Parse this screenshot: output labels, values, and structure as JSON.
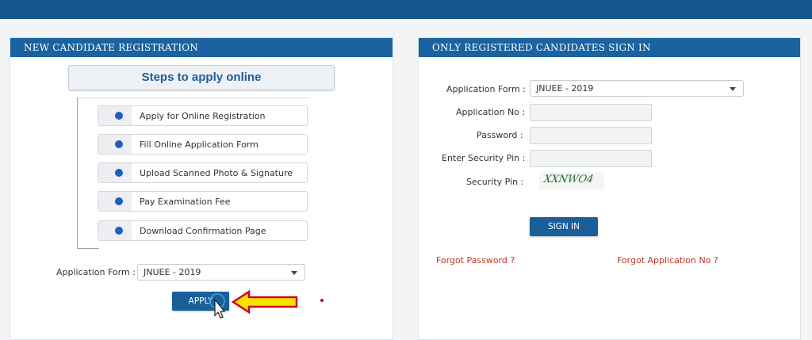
{
  "registration": {
    "header": "NEW CANDIDATE REGISTRATION",
    "steps_title": "Steps to apply online",
    "steps": [
      "Apply for Online Registration",
      "Fill Online Application Form",
      "Upload Scanned Photo & Signature",
      "Pay Examination Fee",
      "Download Confirmation Page"
    ],
    "app_form_label": "Application Form :",
    "app_form_value": "JNUEE - 2019",
    "apply_label": "APPLY"
  },
  "signin": {
    "header": "ONLY REGISTERED CANDIDATES SIGN IN",
    "app_form_label": "Application Form :",
    "app_form_value": "JNUEE - 2019",
    "app_no_label": "Application No :",
    "password_label": "Password :",
    "enter_pin_label": "Enter Security Pin :",
    "pin_label": "Security Pin :",
    "captcha_text": "XXNWO4",
    "sign_in_label": "SIGN IN",
    "forgot_password": "Forgot Password ?",
    "forgot_app_no": "Forgot Application No ?"
  },
  "colors": {
    "topbar": "#14578f",
    "panel_header": "#1a63a0",
    "button": "#1a5e9a",
    "link": "#c0392b",
    "arrow_fill": "#f5e400",
    "arrow_stroke": "#d0021b"
  }
}
